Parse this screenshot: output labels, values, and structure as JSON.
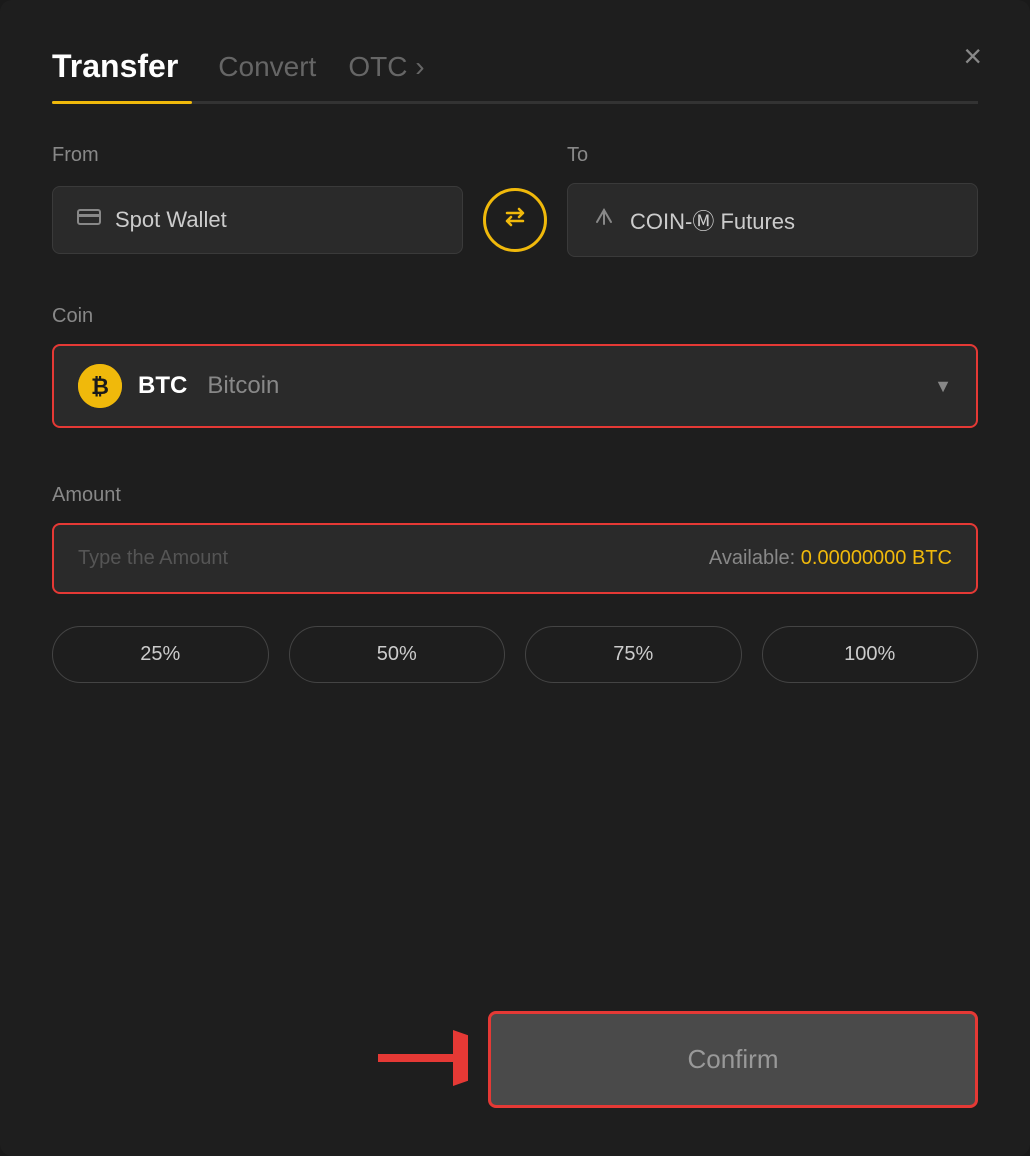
{
  "header": {
    "title": "Transfer",
    "tabs": [
      {
        "id": "transfer",
        "label": "Transfer",
        "active": true
      },
      {
        "id": "convert",
        "label": "Convert",
        "active": false
      },
      {
        "id": "otc",
        "label": "OTC ›",
        "active": false
      }
    ],
    "close_label": "×"
  },
  "from": {
    "label": "From",
    "wallet": "Spot Wallet",
    "wallet_icon": "💳"
  },
  "to": {
    "label": "To",
    "wallet": "COIN-Ⓜ Futures",
    "wallet_icon": "↑"
  },
  "coin": {
    "label": "Coin",
    "selected_symbol": "BTC",
    "selected_name": "Bitcoin",
    "icon_text": "₿"
  },
  "amount": {
    "label": "Amount",
    "placeholder": "Type the Amount",
    "available_label": "Available:",
    "available_value": "0.00000000",
    "available_currency": "BTC"
  },
  "percent_buttons": [
    "25%",
    "50%",
    "75%",
    "100%"
  ],
  "confirm": {
    "label": "Confirm"
  },
  "colors": {
    "accent": "#f0b90b",
    "danger": "#e53935",
    "bg": "#1e1e1e",
    "surface": "#2a2a2a"
  }
}
